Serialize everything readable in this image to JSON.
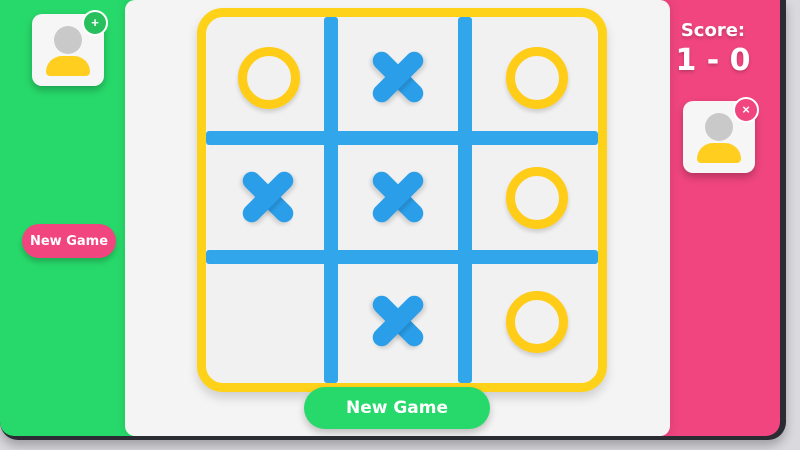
{
  "players": {
    "player1": {
      "badge": "+"
    },
    "player2": {
      "badge": "×"
    }
  },
  "score": {
    "label": "Score:",
    "value": "1 - 0"
  },
  "buttons": {
    "side_new_game": "New Game",
    "main_new_game": "New Game"
  },
  "board": {
    "cells": [
      [
        "O",
        "X",
        "O"
      ],
      [
        "X",
        "X",
        "O"
      ],
      [
        "",
        "X",
        "O"
      ]
    ]
  },
  "colors": {
    "left_panel": "#27d96a",
    "right_panel": "#f0457e",
    "board_frame": "#ffd21a",
    "grid_lines": "#31a6ea",
    "x_mark": "#2a9ee9",
    "o_mark": "#ffcc17"
  }
}
